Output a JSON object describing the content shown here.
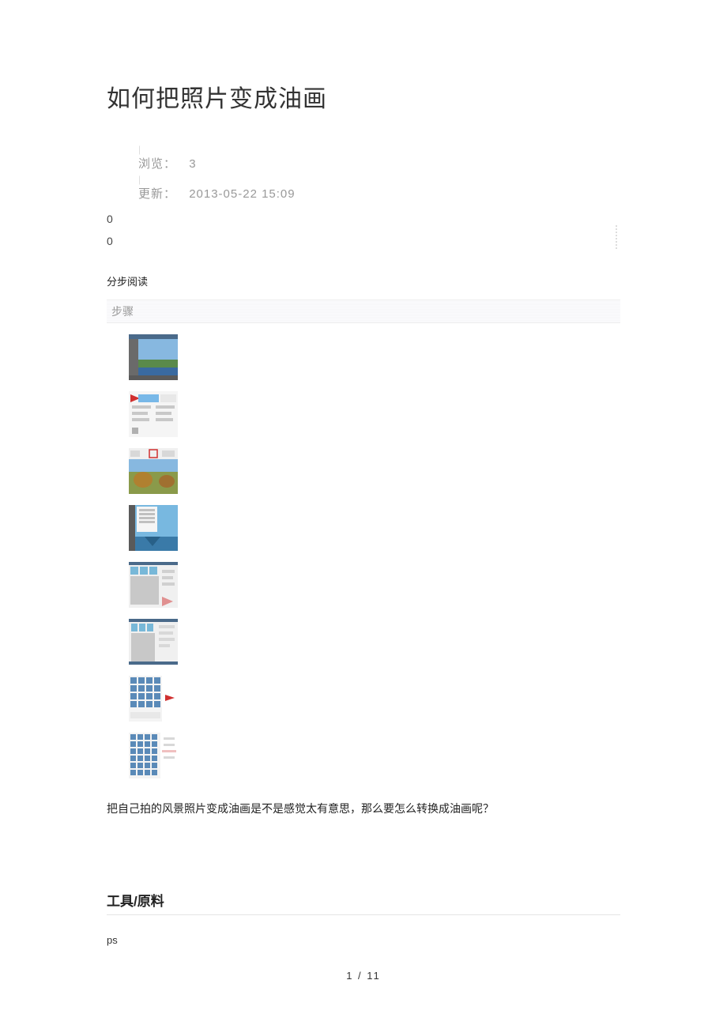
{
  "title": "如何把照片变成油画",
  "meta": {
    "views_label": "浏览：",
    "views_value": "3",
    "updated_label": "更新：",
    "updated_value": "2013-05-22 15:09"
  },
  "count_a": "0",
  "count_b": "0",
  "step_read": "分步阅读",
  "steps_label": "步骤",
  "intro": "把自己拍的风景照片变成油画是不是感觉太有意思，那么要怎么转换成油画呢？",
  "tools_title": "工具/原料",
  "tool_item": "ps",
  "page_num": "1 / 11"
}
